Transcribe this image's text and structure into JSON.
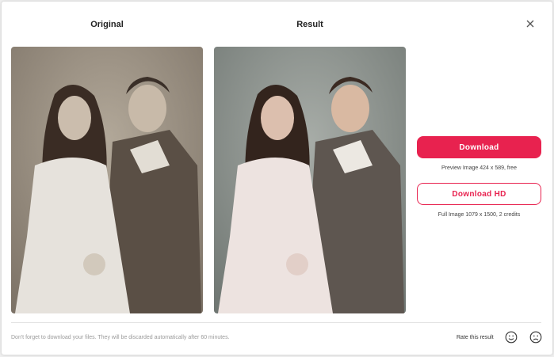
{
  "columns": {
    "original_title": "Original",
    "result_title": "Result"
  },
  "photos": {
    "original_alt": "Original vintage photo of two children",
    "result_alt": "Colorized result photo of two children"
  },
  "actions": {
    "download_label": "Download",
    "download_note": "Preview Image 424 x 589, free",
    "download_hd_label": "Download HD",
    "download_hd_note": "Full Image 1079 x 1500, 2 credits"
  },
  "footer": {
    "note": "Don't forget to download your files. They will be discarded automatically after 60 minutes.",
    "rate_label": "Rate this result"
  },
  "icons": {
    "close": "close-icon",
    "happy": "smile-icon",
    "sad": "frown-icon"
  },
  "colors": {
    "accent": "#e8224f",
    "sepia_bg": "#9a8f82",
    "result_bg": "#8d9490"
  }
}
